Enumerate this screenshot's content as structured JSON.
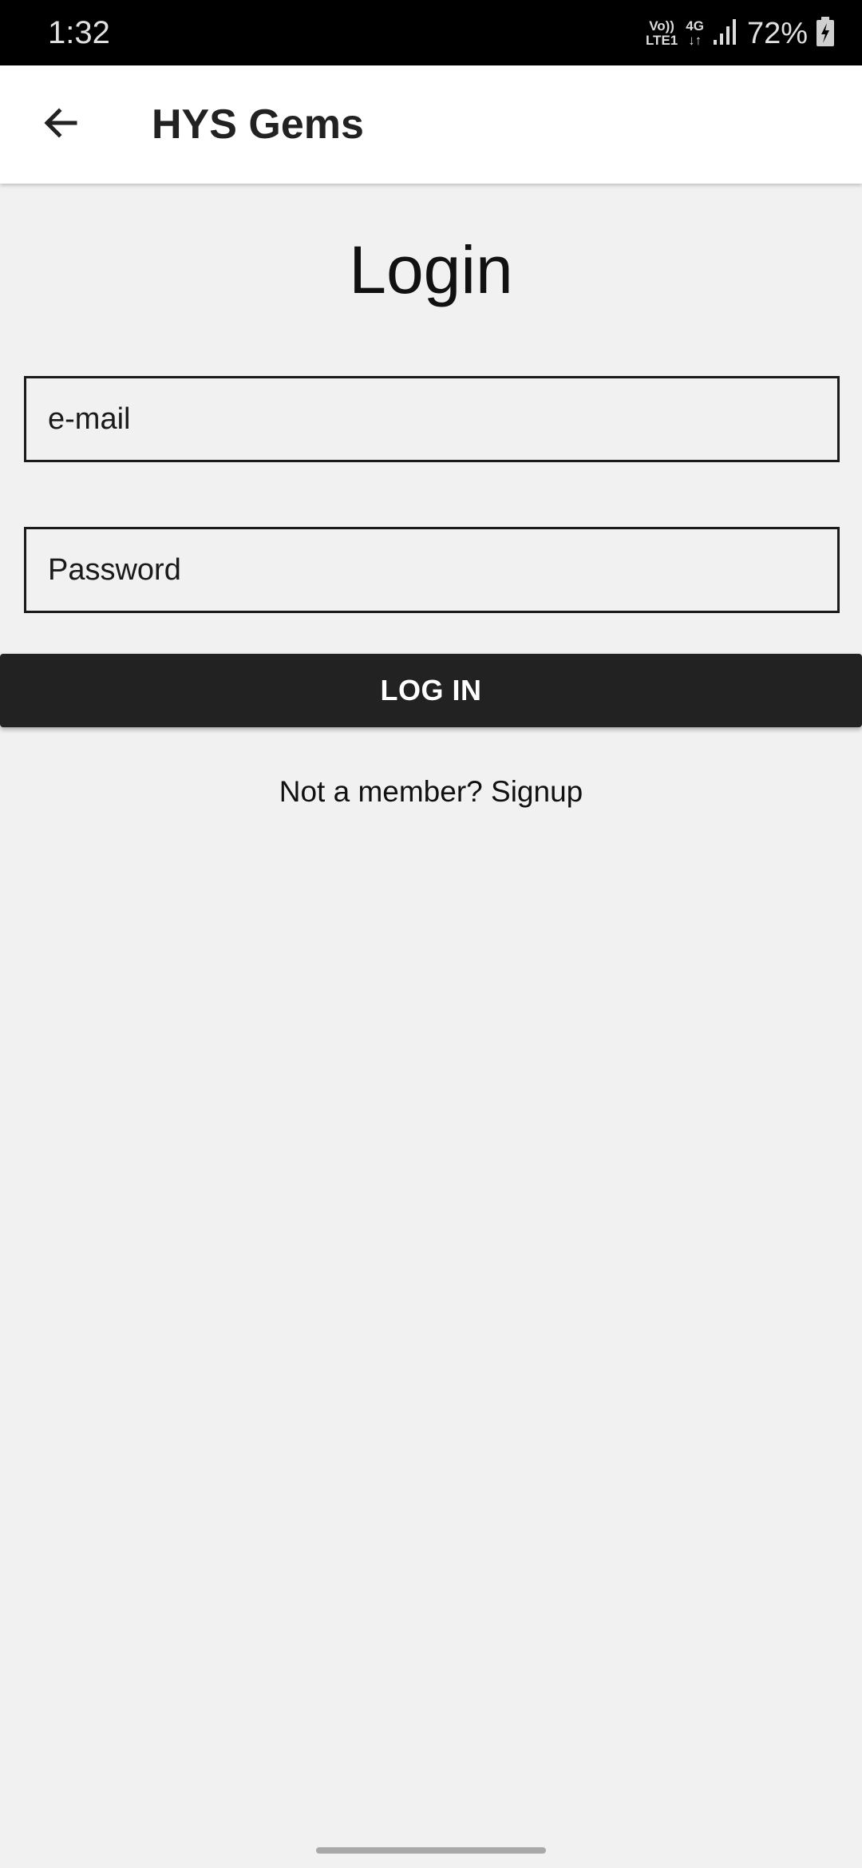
{
  "status_bar": {
    "time": "1:32",
    "volte_top": "Vo))",
    "volte_bottom": "LTE1",
    "network_type": "4G",
    "network_arrows": "↓↑",
    "battery_percent": "72%",
    "icons": [
      "signal-bars-icon",
      "battery-charging-icon"
    ]
  },
  "app_bar": {
    "back_icon": "arrow-left-icon",
    "title": "HYS Gems"
  },
  "login": {
    "heading": "Login",
    "email_placeholder": "e-mail",
    "password_placeholder": "Password",
    "submit_label": "LOG IN",
    "signup_text": "Not a member? Signup"
  },
  "colors": {
    "background": "#f1f1f1",
    "app_bar": "#ffffff",
    "status_bar": "#000000",
    "button": "#222222",
    "button_text": "#ffffff"
  }
}
